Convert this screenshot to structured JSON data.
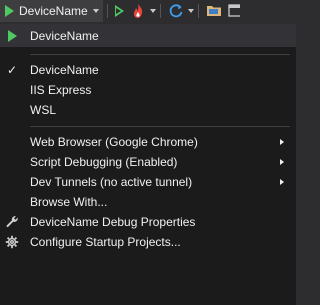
{
  "toolbar": {
    "start_label": "DeviceName"
  },
  "menu": {
    "header_item": "DeviceName",
    "profiles": [
      {
        "label": "DeviceName",
        "checked": true,
        "check_glyph": "✓"
      },
      {
        "label": "IIS Express",
        "checked": false
      },
      {
        "label": "WSL",
        "checked": false
      }
    ],
    "options": [
      {
        "label": "Web Browser (Google Chrome)",
        "submenu": true
      },
      {
        "label": "Script Debugging (Enabled)",
        "submenu": true
      },
      {
        "label": "Dev Tunnels (no active tunnel)",
        "submenu": true
      },
      {
        "label": "Browse With...",
        "submenu": false
      }
    ],
    "actions": [
      {
        "label": "DeviceName Debug Properties",
        "icon": "wrench-icon"
      },
      {
        "label": "Configure Startup Projects...",
        "icon": "gear-icon"
      }
    ]
  },
  "colors": {
    "accent_green": "#4ec962",
    "menu_bg": "#1b1b1c",
    "highlight_bg": "#333337",
    "toolbar_bg": "#2d2d30"
  }
}
